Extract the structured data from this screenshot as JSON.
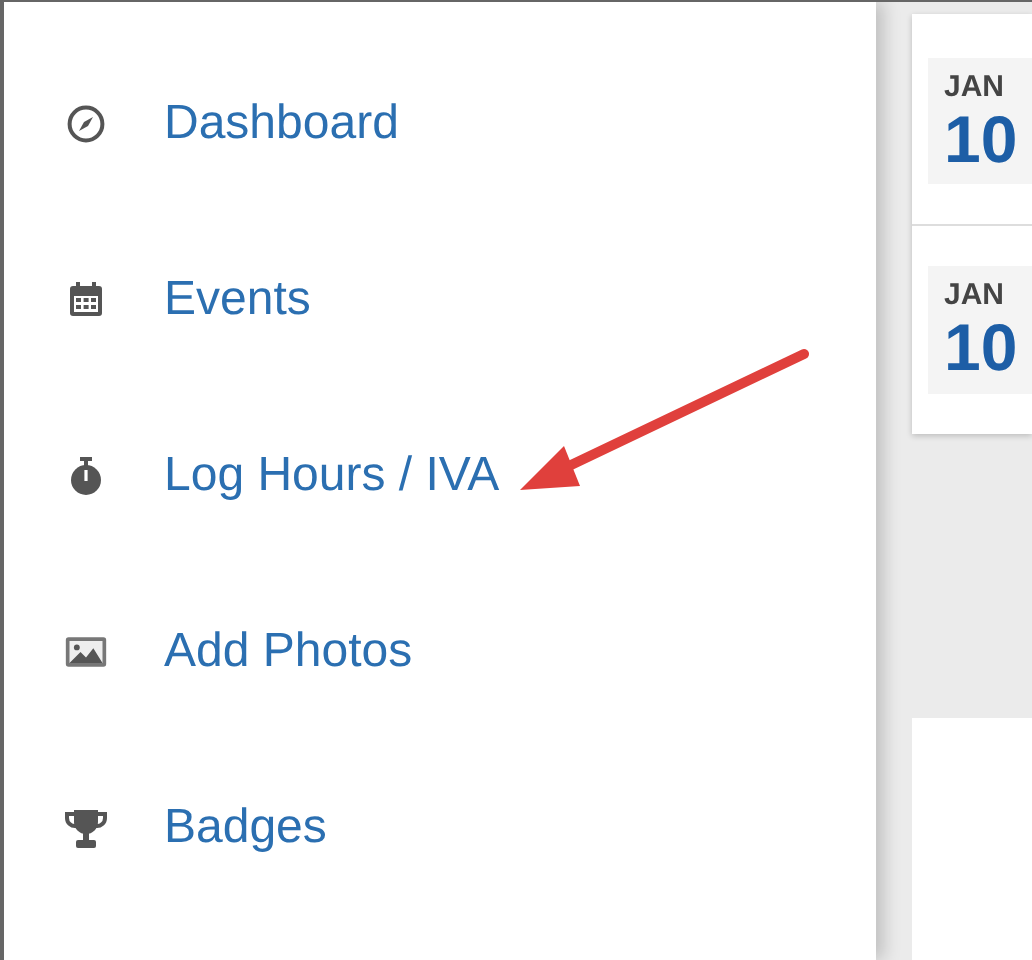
{
  "sidebar": {
    "items": [
      {
        "label": "Dashboard"
      },
      {
        "label": "Events"
      },
      {
        "label": "Log Hours / IVA"
      },
      {
        "label": "Add Photos"
      },
      {
        "label": "Badges"
      }
    ]
  },
  "events": [
    {
      "month": "JAN",
      "day": "10"
    },
    {
      "month": "JAN",
      "day": "10"
    }
  ]
}
